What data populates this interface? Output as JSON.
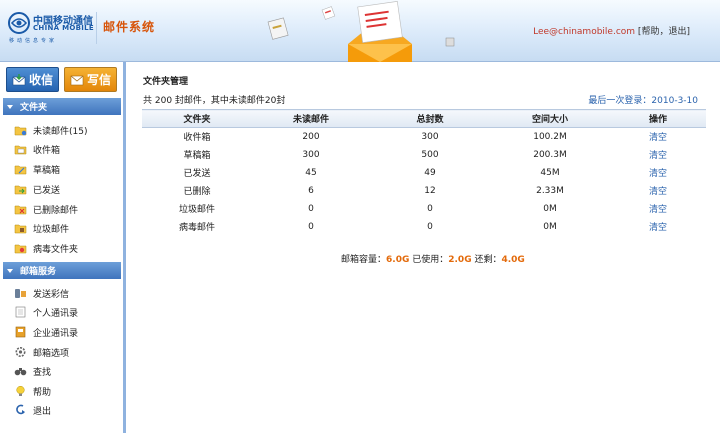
{
  "header": {
    "logo_cn": "中国移动通信",
    "logo_en": "CHINA MOBILE",
    "logo_slogan": "移动信息专家",
    "app_title": "邮件系统",
    "user_email": "Lee@chinamobile.com",
    "help_label": "帮助",
    "logout_label": "退出"
  },
  "sidebar": {
    "receive_label": "收信",
    "write_label": "写信",
    "folders_title": "文件夹",
    "folders": [
      {
        "label": "未读邮件(15)",
        "icon": "unread-folder-icon"
      },
      {
        "label": "收件箱",
        "icon": "inbox-folder-icon"
      },
      {
        "label": "草稿箱",
        "icon": "drafts-folder-icon"
      },
      {
        "label": "已发送",
        "icon": "sent-folder-icon"
      },
      {
        "label": "已删除邮件",
        "icon": "deleted-folder-icon"
      },
      {
        "label": "垃圾邮件",
        "icon": "spam-folder-icon"
      },
      {
        "label": "病毒文件夹",
        "icon": "virus-folder-icon"
      }
    ],
    "services_title": "邮箱服务",
    "services": [
      {
        "label": "发送彩信",
        "icon": "mms-icon"
      },
      {
        "label": "个人通讯录",
        "icon": "address-book-icon"
      },
      {
        "label": "企业通讯录",
        "icon": "company-book-icon"
      },
      {
        "label": "邮箱选项",
        "icon": "settings-gear-icon"
      },
      {
        "label": "查找",
        "icon": "binoculars-icon"
      },
      {
        "label": "帮助",
        "icon": "help-bulb-icon"
      },
      {
        "label": "退出",
        "icon": "exit-arrow-icon"
      }
    ]
  },
  "main": {
    "title": "文件夹管理",
    "summary": "共 200 封邮件，其中未读邮件20封",
    "last_login": "最后一次登录：2010-3-10",
    "columns": [
      "文件夹",
      "未读邮件",
      "总封数",
      "空间大小",
      "操作"
    ],
    "rows": [
      {
        "folder": "收件箱",
        "unread": "200",
        "total": "300",
        "size": "100.2M",
        "action": "清空"
      },
      {
        "folder": "草稿箱",
        "unread": "300",
        "total": "500",
        "size": "200.3M",
        "action": "清空"
      },
      {
        "folder": "已发送",
        "unread": "45",
        "total": "49",
        "size": "45M",
        "action": "清空"
      },
      {
        "folder": "已删除",
        "unread": "6",
        "total": "12",
        "size": "2.33M",
        "action": "清空"
      },
      {
        "folder": "垃圾邮件",
        "unread": "0",
        "total": "0",
        "size": "0M",
        "action": "清空"
      },
      {
        "folder": "病毒邮件",
        "unread": "0",
        "total": "0",
        "size": "0M",
        "action": "清空"
      }
    ],
    "capacity": {
      "capacity_label": "邮箱容量：",
      "capacity_value": "6.0G",
      "used_label": "已使用：",
      "used_value": "2.0G",
      "remain_label": "还剩：",
      "remain_value": "4.0G"
    }
  },
  "colors": {
    "accent_blue": "#2b63ad",
    "brand_orange": "#e36a0b",
    "title_orange": "#d7540a"
  }
}
